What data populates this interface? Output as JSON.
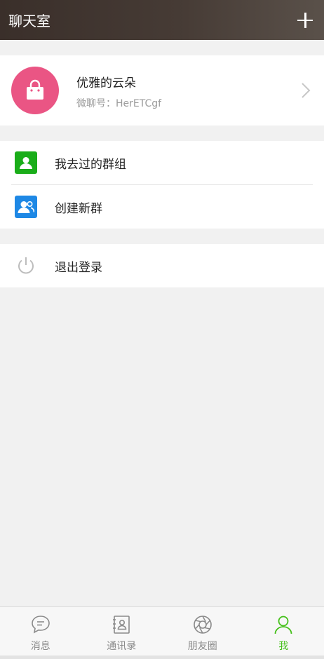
{
  "header": {
    "title": "聊天室",
    "add_icon": "plus-icon"
  },
  "profile": {
    "name": "优雅的云朵",
    "id_text": "微聊号：HerETCgf",
    "avatar_color": "#ea5584",
    "avatar_icon": "shopping-bag-icon"
  },
  "menu": {
    "items": [
      {
        "label": "我去过的群组",
        "icon": "group-visited-icon",
        "color": "#1aad19"
      },
      {
        "label": "创建新群",
        "icon": "create-group-icon",
        "color": "#1e88e5"
      }
    ]
  },
  "logout": {
    "label": "退出登录",
    "icon": "power-icon"
  },
  "tabbar": {
    "tabs": [
      {
        "label": "消息",
        "icon": "chat-bubble-icon"
      },
      {
        "label": "通讯录",
        "icon": "contacts-book-icon"
      },
      {
        "label": "朋友圈",
        "icon": "camera-aperture-icon"
      },
      {
        "label": "我",
        "icon": "person-icon",
        "active": true
      }
    ],
    "active_color": "#45c01a"
  }
}
